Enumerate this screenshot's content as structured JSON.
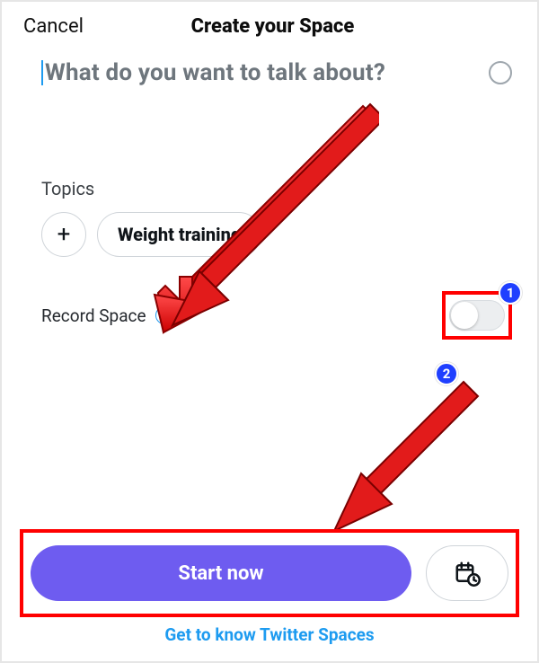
{
  "header": {
    "cancel": "Cancel",
    "title": "Create your Space"
  },
  "input": {
    "placeholder": "What do you want to talk about?",
    "value": ""
  },
  "topics": {
    "label": "Topics",
    "add_icon": "+",
    "items": [
      "Weight training"
    ]
  },
  "record": {
    "label": "Record Space",
    "info_glyph": "i",
    "toggle_on": false
  },
  "actions": {
    "start_label": "Start now"
  },
  "footer": {
    "link_text": "Get to know Twitter Spaces"
  },
  "annotations": {
    "badge1": "1",
    "badge2": "2",
    "highlight_color": "#ff0000",
    "badge_color": "#1f3fff"
  },
  "colors": {
    "accent_blue": "#1d9bf0",
    "primary_purple": "#6e5cf0",
    "placeholder_gray": "#6e767d"
  }
}
